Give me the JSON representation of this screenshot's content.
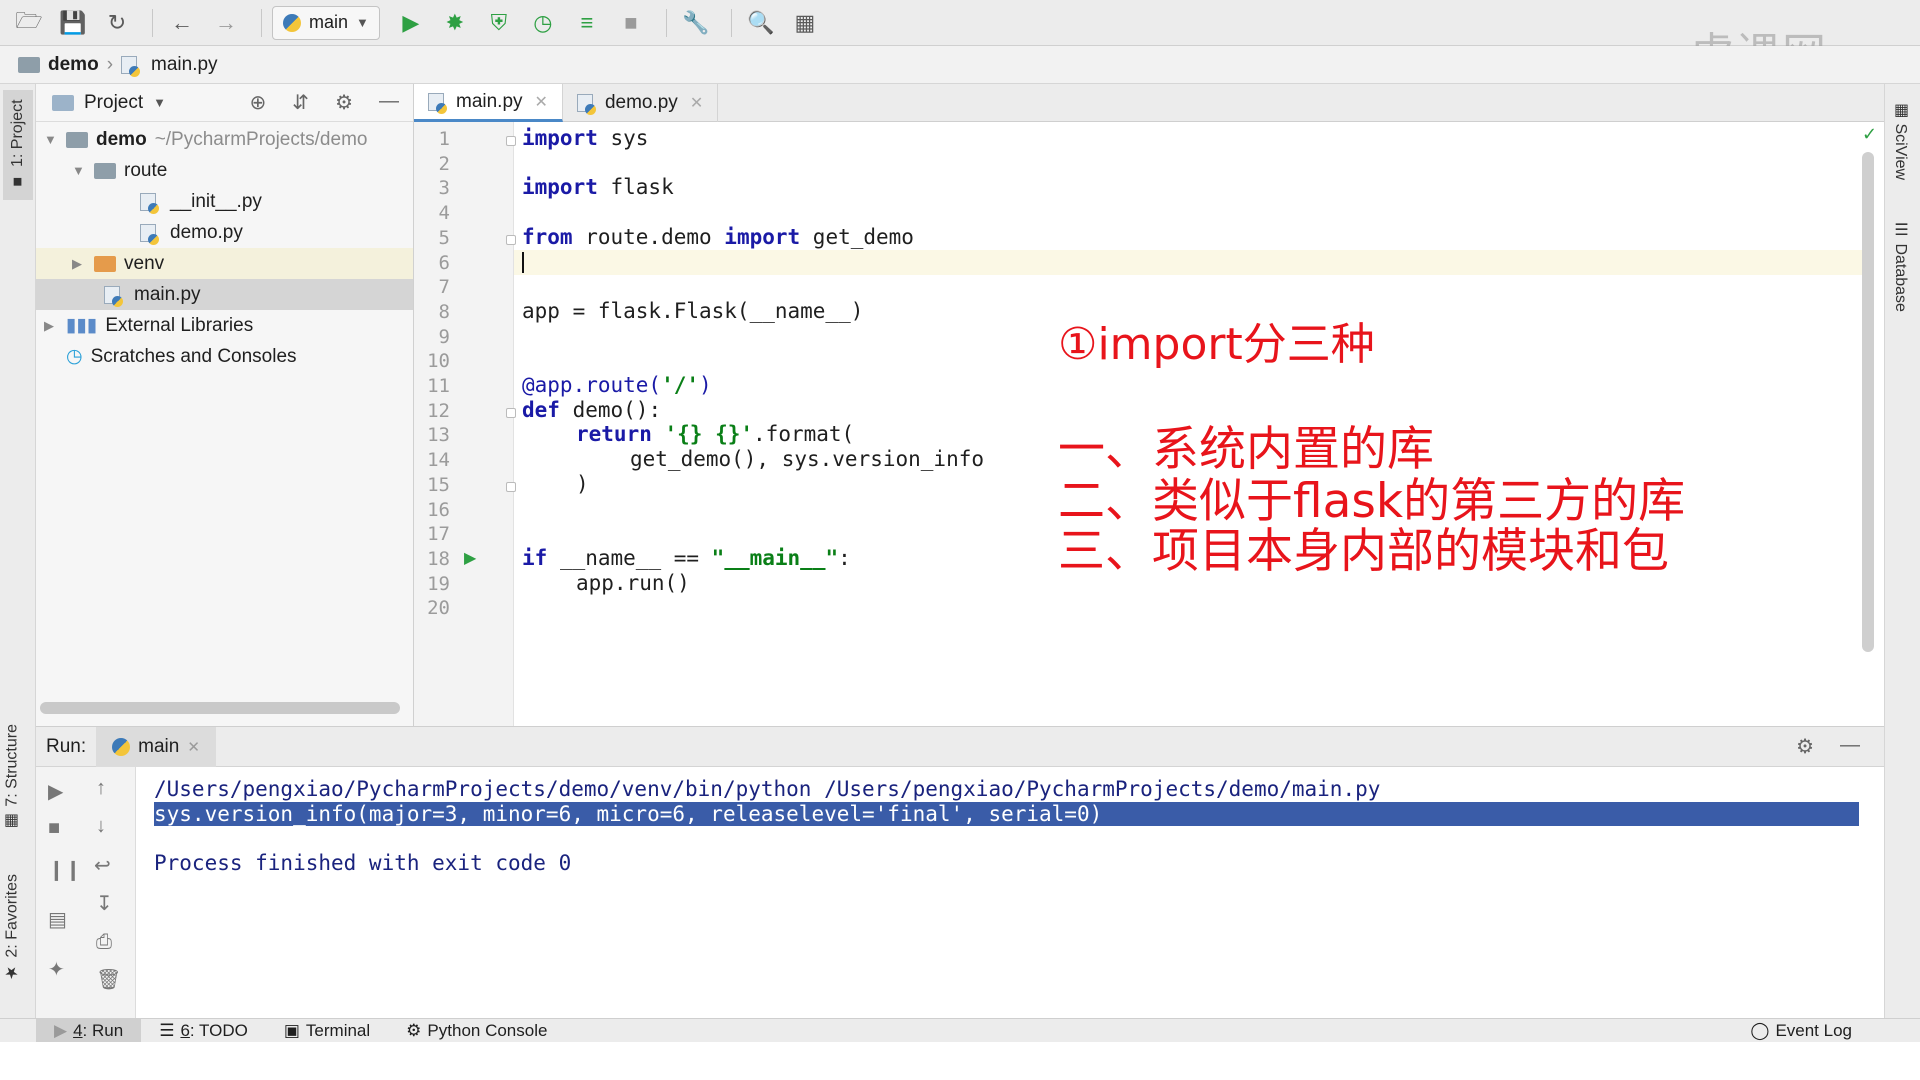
{
  "toolbar": {
    "run_config": "main",
    "icons": [
      "open-folder-icon",
      "save-icon",
      "sync-icon",
      "back-icon",
      "forward-icon",
      "run-icon",
      "debug-icon",
      "coverage-icon",
      "profile-icon",
      "concurrency-icon",
      "stop-icon",
      "wrench-icon",
      "search-icon",
      "vcs-icon"
    ]
  },
  "watermark": "虎课网",
  "breadcrumb": {
    "project": "demo",
    "file": "main.py"
  },
  "left_stripe": {
    "project": "1: Project",
    "structure": "7: Structure",
    "favorites": "2: Favorites"
  },
  "right_stripe": {
    "sciview": "SciView",
    "database": "Database"
  },
  "project_panel": {
    "title": "Project",
    "tree": [
      {
        "label": "demo",
        "extra": "~/PycharmProjects/demo"
      },
      {
        "label": "route"
      },
      {
        "label": "__init__.py"
      },
      {
        "label": "demo.py"
      },
      {
        "label": "venv"
      },
      {
        "label": "main.py"
      },
      {
        "label": "External Libraries"
      },
      {
        "label": "Scratches and Consoles"
      }
    ]
  },
  "editor_tabs": [
    {
      "label": "main.py"
    },
    {
      "label": "demo.py"
    }
  ],
  "line_numbers": [
    "1",
    "2",
    "3",
    "4",
    "5",
    "6",
    "7",
    "8",
    "9",
    "10",
    "11",
    "12",
    "13",
    "14",
    "15",
    "16",
    "17",
    "18",
    "19",
    "20"
  ],
  "code": {
    "l1_kw": "import",
    "l1_rest": " sys",
    "l3_kw": "import",
    "l3_rest": " flask",
    "l5_kw1": "from",
    "l5_mid": " route.demo ",
    "l5_kw2": "import",
    "l5_rest": " get_demo",
    "l8": "app = flask.Flask(__name__)",
    "l11_deco": "@app.route(",
    "l11_str": "'/'",
    "l11_end": ")",
    "l12_kw": "def",
    "l12_rest": " demo():",
    "l13_kw": "return",
    "l13_str": "'{} {}'",
    "l13_rest": ".format(",
    "l14": "get_demo(), sys.version_info",
    "l15": ")",
    "l18_kw": "if",
    "l18_mid": " __name__ == ",
    "l18_str": "\"__main__\"",
    "l18_end": ":",
    "l19": "app.run()"
  },
  "notes": {
    "n1": "①import分三种",
    "n2": "一、系统内置的库",
    "n3": "二、类似于flask的第三方的库",
    "n4": "三、项目本身内部的模块和包"
  },
  "run_panel": {
    "label": "Run:",
    "tab": "main",
    "console": [
      "/Users/pengxiao/PycharmProjects/demo/venv/bin/python /Users/pengxiao/PycharmProjects/demo/main.py",
      "sys.version_info(major=3, minor=6, micro=6, releaselevel='final', serial=0)",
      "",
      "Process finished with exit code 0"
    ]
  },
  "bottom_bar": {
    "run": {
      "num": "4",
      "label": ": Run"
    },
    "todo": {
      "num": "6",
      "label": ": TODO"
    },
    "terminal": "Terminal",
    "python_console": "Python Console",
    "event_log": "Event Log"
  },
  "colors": {
    "keyword": "#1a1aa6",
    "string": "#0a7f17",
    "annotation": "#e8141b",
    "console_highlight": "#3a5ca8"
  }
}
